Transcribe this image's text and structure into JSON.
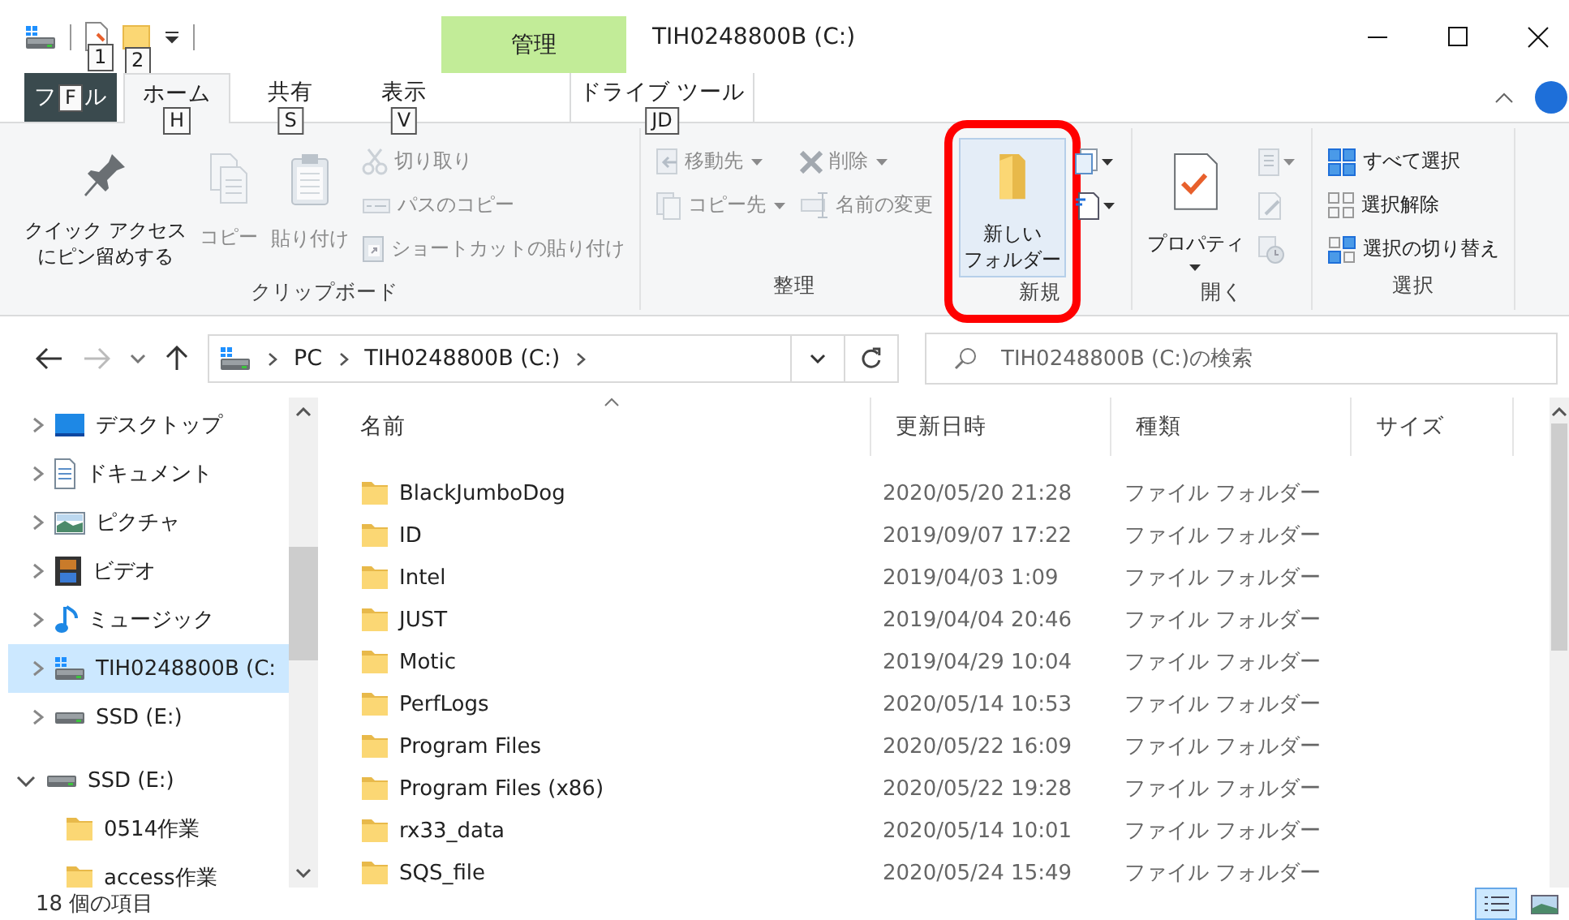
{
  "quick_access": {
    "key_tips": [
      "1",
      "2"
    ]
  },
  "title_bar": {
    "contextual_tab": "管理",
    "title": "TIH0248800B (C:)"
  },
  "ribbon_tabs": [
    {
      "kind": "file",
      "label_start": "フ",
      "key": "F",
      "label_end": "ル",
      "selected": false
    },
    {
      "kind": "normal",
      "label": "ホーム",
      "key": "H",
      "selected": true
    },
    {
      "kind": "normal",
      "label": "共有",
      "key": "S",
      "selected": false
    },
    {
      "kind": "normal",
      "label": "表示",
      "key": "V",
      "selected": false
    },
    {
      "kind": "contextual",
      "label": "ドライブ ツール",
      "key": "JD",
      "selected": false
    }
  ],
  "ribbon_groups": [
    {
      "label": "クリップボード",
      "columns": [
        {
          "kind": "large",
          "items": [
            {
              "kind": "pin",
              "lines": [
                "クイック アクセス",
                "にピン留めする"
              ],
              "disabled": false
            }
          ]
        },
        {
          "kind": "large",
          "items": [
            {
              "kind": "copy",
              "lines": [
                "コピー"
              ],
              "disabled": true
            }
          ]
        },
        {
          "kind": "large",
          "items": [
            {
              "kind": "paste",
              "lines": [
                "貼り付け"
              ],
              "disabled": true
            }
          ]
        },
        {
          "kind": "stack",
          "items": [
            {
              "kind": "cut",
              "lines": [
                "切り取り"
              ],
              "disabled": true
            },
            {
              "kind": "copypath",
              "lines": [
                "パスのコピー"
              ],
              "disabled": true
            },
            {
              "kind": "pasteshortcut",
              "lines": [
                "ショートカットの貼り付け"
              ],
              "disabled": true
            }
          ]
        }
      ]
    },
    {
      "label": "整理",
      "columns": [
        {
          "kind": "stack",
          "items": [
            {
              "kind": "moveto",
              "lines": [
                "移動先"
              ],
              "disabled": true,
              "dropdown": true
            },
            {
              "kind": "copyto",
              "lines": [
                "コピー先"
              ],
              "disabled": true,
              "dropdown": true
            }
          ]
        },
        {
          "kind": "stack",
          "items": [
            {
              "kind": "delete",
              "lines": [
                "削除"
              ],
              "disabled": true,
              "dropdown": true
            },
            {
              "kind": "rename",
              "lines": [
                "名前の変更"
              ],
              "disabled": true
            }
          ]
        }
      ]
    },
    {
      "label": "新規",
      "columns": [
        {
          "kind": "large",
          "items": [
            {
              "kind": "newfolder",
              "lines": [
                "新しい",
                "フォルダー"
              ],
              "disabled": false,
              "highlighted": true
            }
          ]
        },
        {
          "kind": "stack",
          "items": [
            {
              "kind": "newitem",
              "disabled": false,
              "dropdown": true
            },
            {
              "kind": "easyaccess",
              "disabled": false,
              "dropdown": true
            }
          ]
        }
      ]
    },
    {
      "label": "開く",
      "columns": [
        {
          "kind": "large",
          "items": [
            {
              "kind": "properties",
              "lines": [
                "プロパティ"
              ],
              "disabled": false,
              "dropdown": true
            }
          ]
        },
        {
          "kind": "stack",
          "items": [
            {
              "kind": "open",
              "disabled": true,
              "dropdown": true
            },
            {
              "kind": "edit",
              "disabled": true
            },
            {
              "kind": "history",
              "disabled": true
            }
          ]
        }
      ]
    },
    {
      "label": "選択",
      "columns": [
        {
          "kind": "stack",
          "items": [
            {
              "kind": "selectall",
              "lines": [
                "すべて選択"
              ],
              "disabled": false
            },
            {
              "kind": "selectnone",
              "lines": [
                "選択解除"
              ],
              "disabled": false
            },
            {
              "kind": "invert",
              "lines": [
                "選択の切り替え"
              ],
              "disabled": false
            }
          ]
        }
      ]
    }
  ],
  "address_bar": {
    "path": [
      "PC",
      "TIH0248800B (C:)"
    ]
  },
  "search": {
    "placeholder": "TIH0248800B (C:)の検索"
  },
  "navigation_pane": [
    {
      "kind": "desktop",
      "label": "デスクトップ",
      "expanded": false,
      "selected": false
    },
    {
      "kind": "documents",
      "label": "ドキュメント",
      "expanded": false,
      "selected": false
    },
    {
      "kind": "pictures",
      "label": "ピクチャ",
      "expanded": false,
      "selected": false
    },
    {
      "kind": "videos",
      "label": "ビデオ",
      "expanded": false,
      "selected": false
    },
    {
      "kind": "music",
      "label": "ミュージック",
      "expanded": false,
      "selected": false
    },
    {
      "kind": "system",
      "label": "TIH0248800B (C:",
      "expanded": false,
      "selected": true
    },
    {
      "kind": "drive",
      "label": "SSD (E:)",
      "expanded": false,
      "selected": false
    },
    {
      "kind": "drive",
      "label": "SSD (E:)",
      "expanded": true,
      "selected": false,
      "children": [
        {
          "kind": "folder",
          "label": "0514作業",
          "selected": false
        },
        {
          "kind": "folder",
          "label": "access作業",
          "selected": false
        }
      ]
    }
  ],
  "table": {
    "columns": [
      {
        "label": "名前",
        "sorted": true
      },
      {
        "label": "更新日時",
        "sorted": false
      },
      {
        "label": "種類",
        "sorted": false
      },
      {
        "label": "サイズ",
        "sorted": false
      }
    ],
    "rows": [
      {
        "name": "BlackJumboDog",
        "modified": "2020/05/20 21:28",
        "type": "ファイル フォルダー"
      },
      {
        "name": "ID",
        "modified": "2019/09/07 17:22",
        "type": "ファイル フォルダー"
      },
      {
        "name": "Intel",
        "modified": "2019/04/03 1:09",
        "type": "ファイル フォルダー"
      },
      {
        "name": "JUST",
        "modified": "2019/04/04 20:46",
        "type": "ファイル フォルダー"
      },
      {
        "name": "Motic",
        "modified": "2019/04/29 10:04",
        "type": "ファイル フォルダー"
      },
      {
        "name": "PerfLogs",
        "modified": "2020/05/14 10:53",
        "type": "ファイル フォルダー"
      },
      {
        "name": "Program Files",
        "modified": "2020/05/22 16:09",
        "type": "ファイル フォルダー"
      },
      {
        "name": "Program Files (x86)",
        "modified": "2020/05/22 19:28",
        "type": "ファイル フォルダー"
      },
      {
        "name": "rx33_data",
        "modified": "2020/05/14 10:01",
        "type": "ファイル フォルダー"
      },
      {
        "name": "SQS_file",
        "modified": "2020/05/24 15:49",
        "type": "ファイル フォルダー"
      }
    ]
  },
  "status_bar": {
    "item_count": "18 個の項目",
    "views": [
      {
        "kind": "details",
        "selected": true
      },
      {
        "kind": "thumbnails",
        "selected": false
      }
    ]
  }
}
